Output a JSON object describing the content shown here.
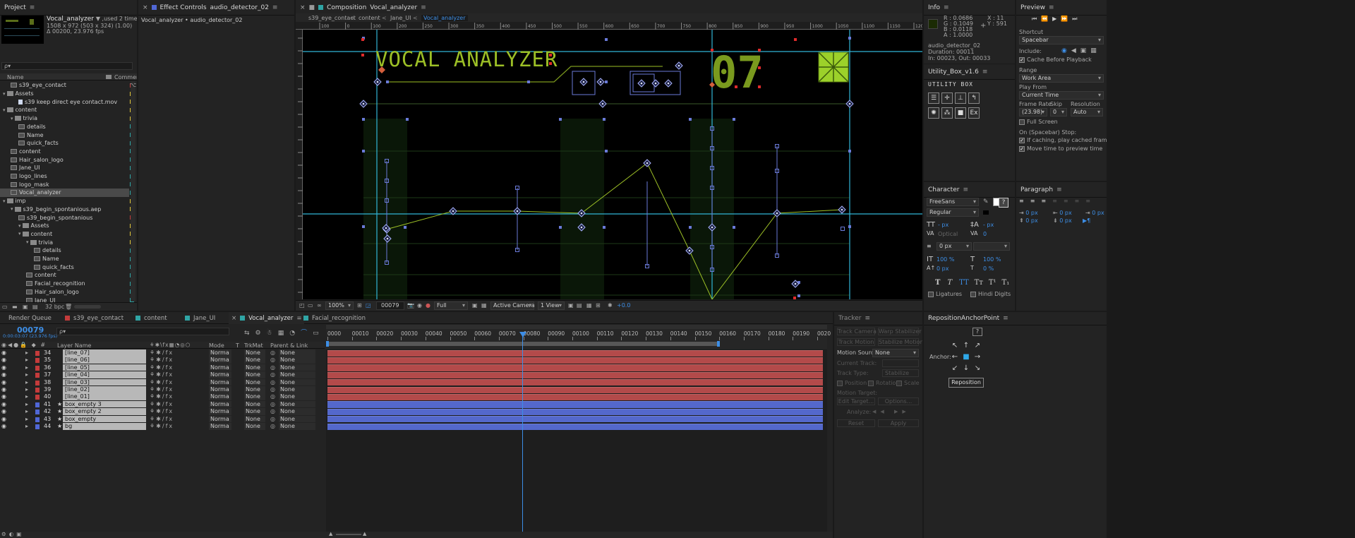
{
  "project": {
    "tab": "Project",
    "selected_name": "Vocal_analyzer",
    "used": "▼ ,used 2 times",
    "size": "1508 x 972  (503 x 324) (1.00)",
    "duration": "Δ 00200, 23.976 fps",
    "search_placeholder": "ρ▾",
    "col_name": "Name",
    "col_comment": "Comment",
    "bpc": "32 bpc",
    "rows": [
      {
        "label": "s39_eye_contact",
        "ind": 1,
        "kind": "comp",
        "color": "#c43b3b"
      },
      {
        "label": "Assets",
        "ind": 0,
        "kind": "folder",
        "color": "#e0c63a"
      },
      {
        "label": "s39 keep direct eye contact.mov",
        "ind": 2,
        "kind": "file",
        "color": "#e0c63a"
      },
      {
        "label": "content",
        "ind": 0,
        "kind": "folder",
        "color": "#e0c63a"
      },
      {
        "label": "trivia",
        "ind": 1,
        "kind": "folder",
        "color": "#e0c63a"
      },
      {
        "label": "details",
        "ind": 2,
        "kind": "comp",
        "color": "#2fa5a5"
      },
      {
        "label": "Name",
        "ind": 2,
        "kind": "comp",
        "color": "#2fa5a5"
      },
      {
        "label": "quick_facts",
        "ind": 2,
        "kind": "comp",
        "color": "#2fa5a5"
      },
      {
        "label": "content",
        "ind": 1,
        "kind": "comp",
        "color": "#2fa5a5"
      },
      {
        "label": "Hair_salon_logo",
        "ind": 1,
        "kind": "comp",
        "color": "#2fa5a5"
      },
      {
        "label": "Jane_UI",
        "ind": 1,
        "kind": "comp",
        "color": "#2fa5a5"
      },
      {
        "label": "logo_lines",
        "ind": 1,
        "kind": "comp",
        "color": "#2fa5a5"
      },
      {
        "label": "logo_mask",
        "ind": 1,
        "kind": "comp",
        "color": "#2fa5a5"
      },
      {
        "label": "Vocal_analyzer",
        "ind": 1,
        "kind": "comp",
        "color": "#2fa5a5",
        "sel": true
      },
      {
        "label": "imp",
        "ind": 0,
        "kind": "folder",
        "color": "#e0c63a"
      },
      {
        "label": "s39_begin_spontanious.aep",
        "ind": 1,
        "kind": "folder",
        "color": "#e0c63a"
      },
      {
        "label": "s39_begin_spontanious",
        "ind": 2,
        "kind": "comp",
        "color": "#c43b3b"
      },
      {
        "label": "Assets",
        "ind": 2,
        "kind": "folder",
        "color": "#e0c63a"
      },
      {
        "label": "content",
        "ind": 2,
        "kind": "folder",
        "color": "#e0c63a"
      },
      {
        "label": "trivia",
        "ind": 3,
        "kind": "folder",
        "color": "#e0c63a"
      },
      {
        "label": "details",
        "ind": 4,
        "kind": "comp",
        "color": "#2fa5a5"
      },
      {
        "label": "Name",
        "ind": 4,
        "kind": "comp",
        "color": "#2fa5a5"
      },
      {
        "label": "quick_facts",
        "ind": 4,
        "kind": "comp",
        "color": "#2fa5a5"
      },
      {
        "label": "content",
        "ind": 3,
        "kind": "comp",
        "color": "#2fa5a5"
      },
      {
        "label": "Facial_recognition",
        "ind": 3,
        "kind": "comp",
        "color": "#2fa5a5"
      },
      {
        "label": "Hair_salon_logo",
        "ind": 3,
        "kind": "comp",
        "color": "#2fa5a5"
      },
      {
        "label": "Jane_UI",
        "ind": 3,
        "kind": "comp",
        "color": "#2fa5a5"
      }
    ]
  },
  "effect_controls": {
    "tab_prefix": "Effect Controls",
    "tab_layer": "audio_detector_02",
    "breadcrumb": "Vocal_analyzer • audio_detector_02"
  },
  "composition": {
    "tab_prefix": "Composition",
    "tab_name": "Vocal_analyzer",
    "crumbs": [
      "s39_eye_contact",
      "content",
      "Jane_UI",
      "Vocal_analyzer"
    ],
    "title_text": "VOCAL ANALYZER",
    "number_text": "07",
    "ruler": [
      "100",
      "0",
      "100",
      "200",
      "250",
      "300",
      "350",
      "400",
      "450",
      "500",
      "550",
      "600",
      "650",
      "700",
      "750",
      "800",
      "850",
      "900",
      "950",
      "1000",
      "1050",
      "1100",
      "1150",
      "1200"
    ],
    "footer": {
      "zoom": "100%",
      "timecode": "00079",
      "resolution": "Full",
      "camera": "Active Camera",
      "view": "1 View",
      "exposure": "+0.0"
    }
  },
  "info": {
    "tab": "Info",
    "r": "R : 0.0686",
    "g": "G : 0.1049",
    "b": "B : 0.0118",
    "a": "A : 1.0000",
    "x": "X : 11",
    "y": "Y : 591",
    "layer": "audio_detector_02",
    "duration": "Duration: 00011",
    "in_out": "In: 00023, Out: 00033"
  },
  "utility": {
    "tab": "Utility_Box_v1.6",
    "logo": "UTILITY BOX"
  },
  "preview": {
    "tab": "Preview",
    "shortcut_label": "Shortcut",
    "shortcut": "Spacebar",
    "include_label": "Include:",
    "cache": "Cache Before Playback",
    "range_label": "Range",
    "range": "Work Area",
    "play_from_label": "Play From",
    "play_from": "Current Time",
    "frame_rate_label": "Frame Rate",
    "skip_label": "Skip",
    "resolution_label": "Resolution",
    "frame_rate": "(23.98)",
    "skip": "0",
    "resolution": "Auto",
    "full_screen": "Full Screen",
    "stop_label": "On (Spacebar) Stop:",
    "stop1": "If caching, play cached frames",
    "stop2": "Move time to preview time"
  },
  "character": {
    "tab": "Character",
    "font": "FreeSans",
    "style": "Regular",
    "px": "- px",
    "optical": "Optical",
    "zero": "0",
    "px2": "- px",
    "size1": "100 %",
    "size2": "100 %",
    "px3": "0 px",
    "pct": "0 %",
    "ligatures": "Ligatures",
    "hindi": "Hindi Digits",
    "styles": [
      "T",
      "T",
      "TT",
      "Tт",
      "T¹",
      "T₁"
    ]
  },
  "paragraph": {
    "tab": "Paragraph",
    "vals": [
      "0 px",
      "0 px",
      "0 px",
      "0 px",
      "0 px"
    ]
  },
  "timeline": {
    "tabs": [
      {
        "label": "Render Queue",
        "color": ""
      },
      {
        "label": "s39_eye_contact",
        "color": "#c43b3b"
      },
      {
        "label": "content",
        "color": "#2fa5a5"
      },
      {
        "label": "Jane_UI",
        "color": "#2fa5a5"
      },
      {
        "label": "Vocal_analyzer",
        "color": "#2fa5a5",
        "active": true
      },
      {
        "label": "Facial_recognition",
        "color": "#2fa5a5"
      }
    ],
    "timecode": "00079",
    "sub_tc": "0:00:03:07 (23.976 fps)",
    "search_placeholder": "ρ▾",
    "headers": {
      "layer_name": "Layer Name",
      "mode": "Mode",
      "t": "T",
      "trkmat": "TrkMat",
      "parent": "Parent & Link"
    },
    "ruler": [
      "0000",
      "00010",
      "00020",
      "00030",
      "00040",
      "00050",
      "00060",
      "00070",
      "00080",
      "00090",
      "00100",
      "00110",
      "00120",
      "00130",
      "00140",
      "00150",
      "00160",
      "00170",
      "00180",
      "00190",
      "0020"
    ],
    "layers": [
      {
        "num": "34",
        "name": "[line_07]",
        "color": "#c43b3b",
        "mode": "Norma",
        "trk": "None",
        "parent": "None"
      },
      {
        "num": "35",
        "name": "[line_06]",
        "color": "#c43b3b",
        "mode": "Norma",
        "trk": "None",
        "parent": "None"
      },
      {
        "num": "36",
        "name": "[line_05]",
        "color": "#c43b3b",
        "mode": "Norma",
        "trk": "None",
        "parent": "None"
      },
      {
        "num": "37",
        "name": "[line_04]",
        "color": "#c43b3b",
        "mode": "Norma",
        "trk": "None",
        "parent": "None"
      },
      {
        "num": "38",
        "name": "[line_03]",
        "color": "#c43b3b",
        "mode": "Norma",
        "trk": "None",
        "parent": "None"
      },
      {
        "num": "39",
        "name": "[line_02]",
        "color": "#c43b3b",
        "mode": "Norma",
        "trk": "None",
        "parent": "None"
      },
      {
        "num": "40",
        "name": "[line_01]",
        "color": "#c43b3b",
        "mode": "Norma",
        "trk": "None",
        "parent": "None"
      },
      {
        "num": "41",
        "name": "box_empty 3",
        "color": "#5067d6",
        "mode": "Norma",
        "trk": "None",
        "parent": "None",
        "star": true
      },
      {
        "num": "42",
        "name": "box_empty 2",
        "color": "#5067d6",
        "mode": "Norma",
        "trk": "None",
        "parent": "None",
        "star": true
      },
      {
        "num": "43",
        "name": "box_empty",
        "color": "#5067d6",
        "mode": "Norma",
        "trk": "None",
        "parent": "None",
        "star": true
      },
      {
        "num": "44",
        "name": "bg",
        "color": "#5067d6",
        "mode": "Norma",
        "trk": "None",
        "parent": "None",
        "star": true
      }
    ]
  },
  "tracker": {
    "tab": "Tracker",
    "track_camera": "Track Camera",
    "warp": "Warp Stabilizer",
    "track_motion": "Track Motion",
    "stabilize": "Stabilize Motion",
    "motion_source_label": "Motion Source:",
    "motion_source": "None",
    "current_track": "Current Track:",
    "track_type": "Track Type:",
    "track_type_val": "Stabilize",
    "position": "Position",
    "rotation": "Rotation",
    "scale": "Scale",
    "motion_target": "Motion Target:",
    "edit_target": "Edit Target...",
    "options": "Options...",
    "analyze": "Analyze:",
    "reset": "Reset",
    "apply": "Apply"
  },
  "anchor": {
    "tab": "RepositionAnchorPoint",
    "help": "?",
    "anchor_label": "Anchor:",
    "reposition": "Reposition"
  }
}
